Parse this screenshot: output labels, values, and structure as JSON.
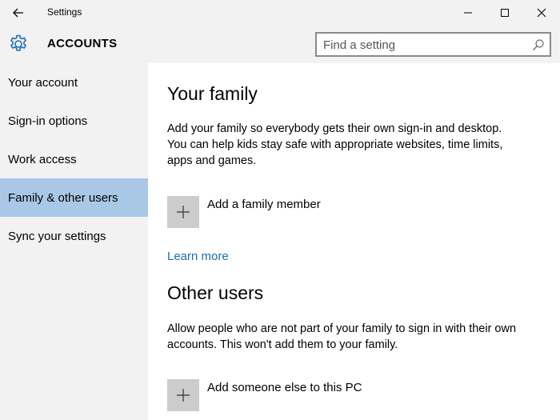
{
  "window": {
    "title": "Settings",
    "icons": {
      "back": "back-arrow-icon",
      "minimize": "minimize-icon",
      "maximize": "maximize-icon",
      "close": "close-icon"
    }
  },
  "header": {
    "section_title": "ACCOUNTS",
    "icon": "gear-icon",
    "search_placeholder": "Find a setting",
    "accent_color": "#1a6fb5"
  },
  "sidebar": {
    "items": [
      {
        "label": "Your account",
        "selected": false
      },
      {
        "label": "Sign-in options",
        "selected": false
      },
      {
        "label": "Work access",
        "selected": false
      },
      {
        "label": "Family & other users",
        "selected": true
      },
      {
        "label": "Sync your settings",
        "selected": false
      }
    ],
    "selected_color": "#a8c8e6"
  },
  "main": {
    "family": {
      "heading": "Your family",
      "description": "Add your family so everybody gets their own sign-in and desktop. You can help kids stay safe with appropriate websites, time limits, apps and games.",
      "add_label": "Add a family member",
      "learn_more": "Learn more"
    },
    "other_users": {
      "heading": "Other users",
      "description": "Allow people who are not part of your family to sign in with their own accounts. This won't add them to your family.",
      "add_label": "Add someone else to this PC"
    }
  }
}
